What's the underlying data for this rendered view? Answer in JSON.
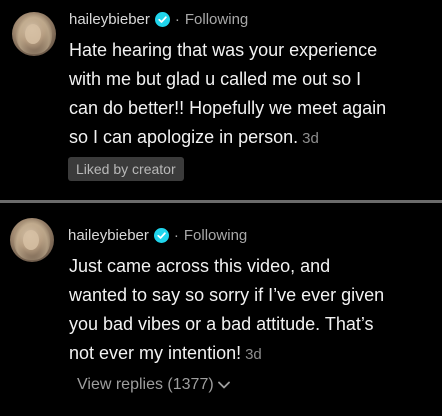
{
  "comments": [
    {
      "username": "haileybieber",
      "following_label": "Following",
      "separator": "·",
      "text": "Hate hearing that was your experience\nwith me but glad u called me out so I\ncan do better!! Hopefully we meet again\nso I can apologize in person.",
      "timestamp": "3d",
      "liked_badge": "Liked by creator"
    },
    {
      "username": "haileybieber",
      "following_label": "Following",
      "separator": "·",
      "text": "Just came across this video, and\nwanted to say so sorry if I’ve ever given\nyou bad vibes or a bad attitude. That’s\nnot ever my intention!",
      "timestamp": "3d",
      "view_replies_label": "View replies (1377)"
    }
  ],
  "icons": {
    "verified": "verified-badge-icon",
    "chevron": "chevron-down-icon"
  },
  "colors": {
    "background": "#000000",
    "verified_blue": "#20d5ec",
    "divider": "#6b6b6b",
    "muted_text": "#a8a8a8"
  }
}
